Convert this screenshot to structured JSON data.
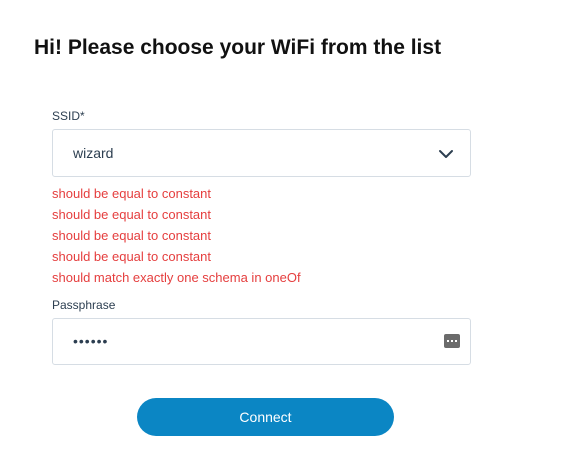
{
  "page": {
    "title": "Hi! Please choose your WiFi from the list"
  },
  "ssid": {
    "label": "SSID*",
    "value": "wizard",
    "dropdown_icon": "chevron-down-icon"
  },
  "errors": [
    "should be equal to constant",
    "should be equal to constant",
    "should be equal to constant",
    "should be equal to constant",
    "should match exactly one schema in oneOf"
  ],
  "passphrase": {
    "label": "Passphrase",
    "value": "••••••",
    "icon": "keyboard-icon"
  },
  "connect": {
    "label": "Connect"
  },
  "colors": {
    "accent": "#0b86c4",
    "error": "#e53e3e",
    "border": "#d6dde4"
  }
}
